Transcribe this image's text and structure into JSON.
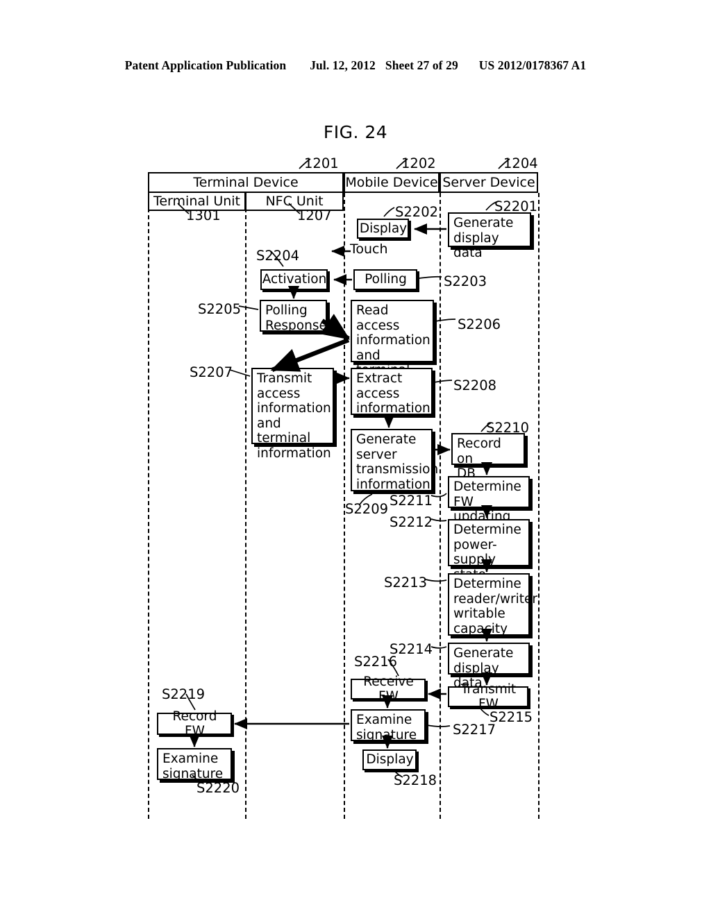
{
  "publication_header": {
    "left": "Patent Application Publication",
    "date": "Jul. 12, 2012",
    "sheet": "Sheet 27 of 29",
    "number": "US 2012/0178367 A1"
  },
  "figure": {
    "title": "FIG. 24"
  },
  "lanes": {
    "group_terminal": "Terminal Device",
    "group_mobile": "Mobile Device",
    "group_server": "Server Device",
    "sub_terminal_unit": "Terminal Unit",
    "sub_nfc_unit": "NFC Unit"
  },
  "lane_refs": {
    "terminal_device": "1201",
    "mobile_device": "1202",
    "server_device": "1204",
    "terminal_unit": "1301",
    "nfc_unit": "1207"
  },
  "steps": [
    {
      "id": "S2201",
      "label": "Generate\ndisplay data",
      "lane": "server"
    },
    {
      "id": "S2202",
      "label": "Display",
      "lane": "mobile"
    },
    {
      "id": "S2203",
      "label": "Polling",
      "lane": "mobile"
    },
    {
      "id": "S2204",
      "label": "Activation",
      "lane": "nfc"
    },
    {
      "id": "S2205",
      "label": "Polling\nResponse",
      "lane": "nfc"
    },
    {
      "id": "S2206",
      "label": "Read access\ninformation\nand terminal\nInformation",
      "lane": "mobile"
    },
    {
      "id": "S2207",
      "label": "Transmit\naccess\ninformation\nand terminal\ninformation",
      "lane": "nfc"
    },
    {
      "id": "S2208",
      "label": "Extract\naccess\ninformation",
      "lane": "mobile"
    },
    {
      "id": "S2209",
      "label": "Generate\nserver\ntransmission\ninformation",
      "lane": "mobile"
    },
    {
      "id": "S2210",
      "label": "Record on\nDB",
      "lane": "server"
    },
    {
      "id": "S2211",
      "label": "Determine\nFW updating",
      "lane": "server"
    },
    {
      "id": "S2212",
      "label": "Determine\npower-supply\nstate",
      "lane": "server"
    },
    {
      "id": "S2213",
      "label": "Determine\nreader/writer\nwritable\ncapacity",
      "lane": "server"
    },
    {
      "id": "S2214",
      "label": "Generate\ndisplay data",
      "lane": "server"
    },
    {
      "id": "S2215",
      "label": "Transmit FW",
      "lane": "server"
    },
    {
      "id": "S2216",
      "label": "Receive FW",
      "lane": "mobile"
    },
    {
      "id": "S2217",
      "label": "Examine\nsignature",
      "lane": "mobile"
    },
    {
      "id": "S2218",
      "label": "Display",
      "lane": "mobile"
    },
    {
      "id": "S2219",
      "label": "Record FW",
      "lane": "terminal"
    },
    {
      "id": "S2220",
      "label": "Examine\nsignature",
      "lane": "terminal"
    }
  ],
  "annotations": {
    "touch": "Touch"
  }
}
